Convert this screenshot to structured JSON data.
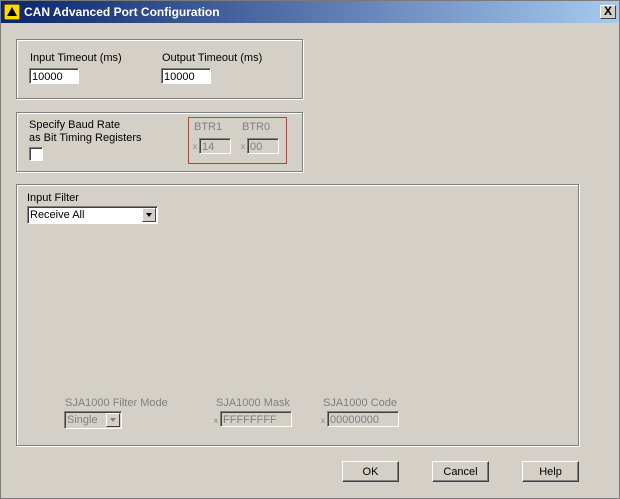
{
  "window": {
    "title": "CAN Advanced Port Configuration",
    "close_label": "X"
  },
  "timeouts": {
    "input_label": "Input Timeout (ms)",
    "input_value": "10000",
    "output_label": "Output Timeout (ms)",
    "output_value": "10000"
  },
  "baud": {
    "specify_label_line1": "Specify Baud Rate",
    "specify_label_line2": "as Bit Timing Registers",
    "checked": false,
    "btr1_label": "BTR1",
    "btr1_value": "14",
    "btr0_label": "BTR0",
    "btr0_value": "00",
    "hex_prefix": "x"
  },
  "filter": {
    "label": "Input Filter",
    "selected": "Receive All",
    "mode_label": "SJA1000 Filter Mode",
    "mode_value": "Single",
    "mask_label": "SJA1000 Mask",
    "mask_value": "FFFFFFFF",
    "code_label": "SJA1000 Code",
    "code_value": "00000000",
    "hex_prefix": "x"
  },
  "buttons": {
    "ok": "OK",
    "cancel": "Cancel",
    "help": "Help"
  },
  "colors": {
    "title_start": "#0a246a",
    "title_end": "#a6caf0",
    "highlight_box": "#e03030",
    "face": "#d4d0c8"
  }
}
